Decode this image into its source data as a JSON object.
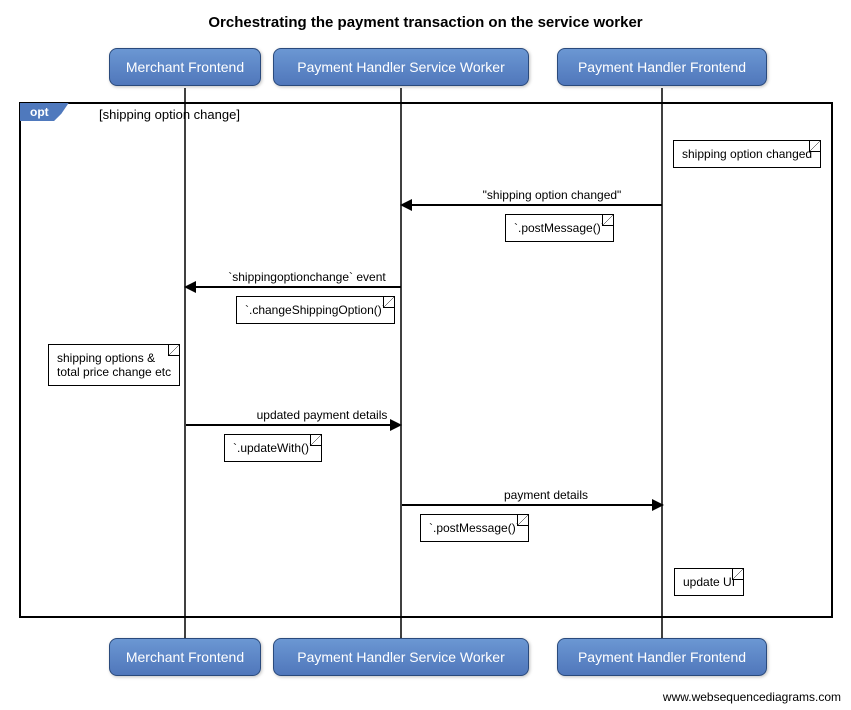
{
  "title": "Orchestrating the payment transaction on the service worker",
  "participants": {
    "p1": "Merchant Frontend",
    "p2": "Payment Handler Service Worker",
    "p3": "Payment Handler Frontend"
  },
  "frame": {
    "tag": "opt",
    "condition": "[shipping option change]"
  },
  "messages": {
    "m1": {
      "label": "\"shipping option changed\"",
      "note": "`.postMessage()`"
    },
    "m2": {
      "label": "`shippingoptionchange` event",
      "note": "`.changeShippingOption()`"
    },
    "m3": {
      "label": "updated payment details",
      "note": "`.updateWith()`"
    },
    "m4": {
      "label": "payment details",
      "note": "`.postMessage()`"
    }
  },
  "notes": {
    "n1": "shipping option changed",
    "n2": "shipping options &\ntotal price change etc",
    "n3": "update UI"
  },
  "attribution": "www.websequencediagrams.com",
  "chart_data": {
    "type": "sequence-diagram",
    "title": "Orchestrating the payment transaction on the service worker",
    "participants": [
      "Merchant Frontend",
      "Payment Handler Service Worker",
      "Payment Handler Frontend"
    ],
    "frame": {
      "type": "opt",
      "condition": "shipping option change"
    },
    "events": [
      {
        "type": "note",
        "on": "Payment Handler Frontend",
        "text": "shipping option changed"
      },
      {
        "type": "message",
        "from": "Payment Handler Frontend",
        "to": "Payment Handler Service Worker",
        "label": "\"shipping option changed\"",
        "call": ".postMessage()"
      },
      {
        "type": "message",
        "from": "Payment Handler Service Worker",
        "to": "Merchant Frontend",
        "label": "`shippingoptionchange` event",
        "call": ".changeShippingOption()"
      },
      {
        "type": "note",
        "on": "Merchant Frontend",
        "text": "shipping options & total price change etc"
      },
      {
        "type": "message",
        "from": "Merchant Frontend",
        "to": "Payment Handler Service Worker",
        "label": "updated payment details",
        "call": ".updateWith()"
      },
      {
        "type": "message",
        "from": "Payment Handler Service Worker",
        "to": "Payment Handler Frontend",
        "label": "payment details",
        "call": ".postMessage()"
      },
      {
        "type": "note",
        "on": "Payment Handler Frontend",
        "text": "update UI"
      }
    ]
  }
}
